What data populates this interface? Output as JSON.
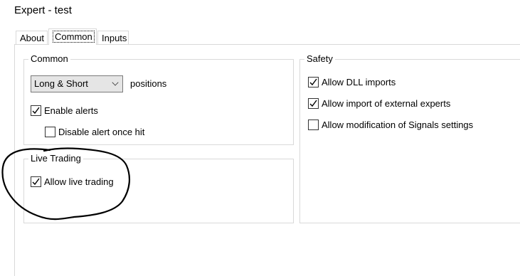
{
  "window": {
    "title": "Expert - test"
  },
  "tabs": [
    {
      "label": "About"
    },
    {
      "label": "Common",
      "selected": true
    },
    {
      "label": "Inputs"
    }
  ],
  "common": {
    "group_title": "Common",
    "positions_select": {
      "value": "Long & Short",
      "suffix": "positions"
    },
    "enable_alerts": {
      "label": "Enable alerts",
      "checked": true
    },
    "disable_alert_once_hit": {
      "label": "Disable alert once hit",
      "checked": false
    }
  },
  "live_trading": {
    "group_title": "Live Trading",
    "allow_live_trading": {
      "label": "Allow live trading",
      "checked": true
    }
  },
  "safety": {
    "group_title": "Safety",
    "allow_dll_imports": {
      "label": "Allow DLL imports",
      "checked": true
    },
    "allow_external_experts": {
      "label": "Allow import of external experts",
      "checked": true
    },
    "allow_signals_modification": {
      "label": "Allow modification of Signals settings",
      "checked": false
    }
  },
  "annotation": {
    "color": "#000000",
    "shape": "hand-drawn-circle"
  }
}
